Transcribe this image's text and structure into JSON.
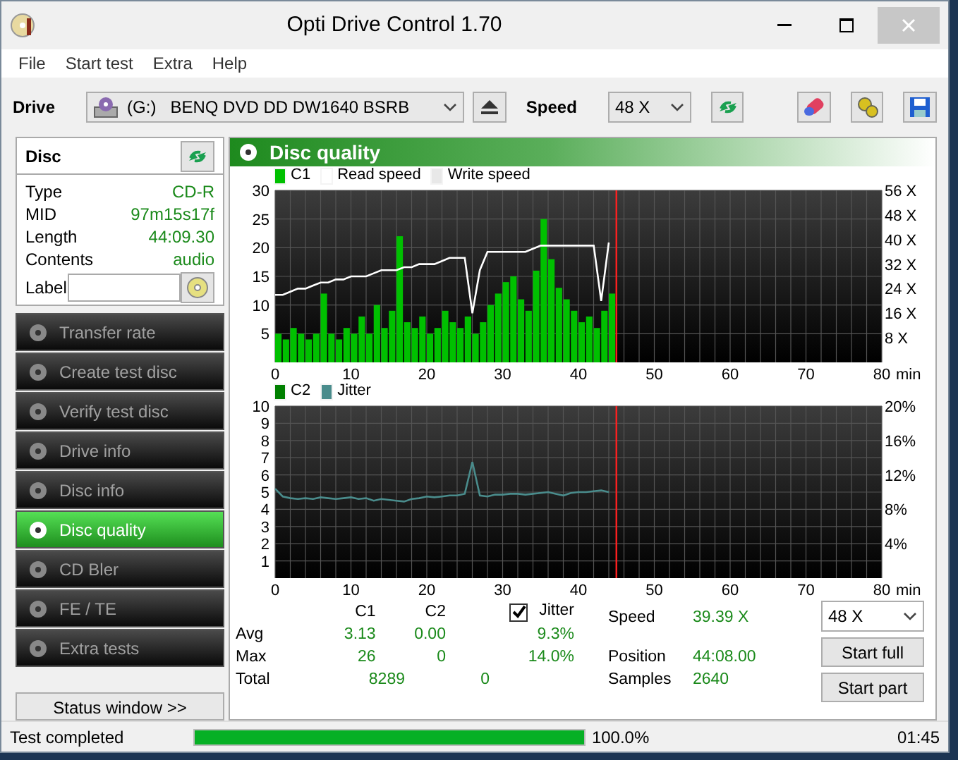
{
  "window": {
    "title": "Opti Drive Control 1.70"
  },
  "menu": [
    "File",
    "Start test",
    "Extra",
    "Help"
  ],
  "toolbar": {
    "drive_label": "Drive",
    "drive": "(G:)   BENQ DVD DD DW1640 BSRB",
    "speed_label": "Speed",
    "speed": "48 X"
  },
  "disc": {
    "title": "Disc",
    "fields": [
      {
        "label": "Type",
        "value": "CD-R"
      },
      {
        "label": "MID",
        "value": "97m15s17f"
      },
      {
        "label": "Length",
        "value": "44:09.30"
      },
      {
        "label": "Contents",
        "value": "audio"
      }
    ],
    "label_field": "Label"
  },
  "nav": [
    {
      "label": "Transfer rate",
      "selected": false
    },
    {
      "label": "Create test disc",
      "selected": false
    },
    {
      "label": "Verify test disc",
      "selected": false
    },
    {
      "label": "Drive info",
      "selected": false
    },
    {
      "label": "Disc info",
      "selected": false
    },
    {
      "label": "Disc quality",
      "selected": true
    },
    {
      "label": "CD Bler",
      "selected": false
    },
    {
      "label": "FE / TE",
      "selected": false
    },
    {
      "label": "Extra tests",
      "selected": false
    }
  ],
  "status_window_button": "Status window >>",
  "panel": {
    "title": "Disc quality",
    "charts": [
      {
        "chart_data": {
          "type": "bar",
          "xlabel": "min",
          "x": [
            0,
            1,
            2,
            3,
            4,
            5,
            6,
            7,
            8,
            9,
            10,
            11,
            12,
            13,
            14,
            15,
            16,
            17,
            18,
            19,
            20,
            21,
            22,
            23,
            24,
            25,
            26,
            27,
            28,
            29,
            30,
            31,
            32,
            33,
            34,
            35,
            36,
            37,
            38,
            39,
            40,
            41,
            42,
            43,
            44
          ],
          "xlim": [
            0,
            80
          ],
          "ylim": [
            0,
            30
          ],
          "xticks": [
            0,
            10,
            20,
            30,
            40,
            50,
            60,
            70,
            80
          ],
          "yticks": [
            5,
            10,
            15,
            20,
            25,
            30
          ],
          "grid": true,
          "ref_lines": [
            {
              "axis": "x",
              "value": 45,
              "color": "#ff2020"
            }
          ],
          "y2lim": [
            0,
            56
          ],
          "y2ticks": [
            {
              "value": 8,
              "label": "8 X"
            },
            {
              "value": 16,
              "label": "16 X"
            },
            {
              "value": 24,
              "label": "24 X"
            },
            {
              "value": 32,
              "label": "32 X"
            },
            {
              "value": 40,
              "label": "40 X"
            },
            {
              "value": 48,
              "label": "48 X"
            },
            {
              "value": 56,
              "label": "56 X"
            }
          ],
          "series": [
            {
              "name": "C1",
              "color": "#00c000",
              "values": [
                5,
                4,
                6,
                5,
                4,
                5,
                12,
                5,
                4,
                6,
                5,
                8,
                5,
                10,
                6,
                9,
                22,
                7,
                6,
                8,
                5,
                6,
                9,
                7,
                6,
                8,
                5,
                7,
                10,
                12,
                14,
                15,
                11,
                9,
                16,
                25,
                18,
                13,
                11,
                9,
                7,
                8,
                6,
                9,
                12
              ]
            },
            {
              "name": "Read speed",
              "color": "#ffffff",
              "type": "line",
              "axis": "y2",
              "values": [
                22,
                22,
                23,
                24,
                24,
                25,
                26,
                26,
                27,
                27,
                28,
                28,
                28,
                29,
                30,
                30,
                30,
                31,
                31,
                32,
                32,
                32,
                33,
                34,
                34,
                34,
                16,
                30,
                36,
                36,
                36,
                36,
                36,
                36,
                37,
                38,
                38,
                38,
                38,
                38,
                38,
                38,
                38,
                20,
                39
              ]
            }
          ]
        },
        "extra_legend": [
          {
            "label": "Write speed",
            "color": "#e8e8e8"
          }
        ]
      },
      {
        "chart_data": {
          "type": "bar",
          "xlabel": "min",
          "x": [
            0,
            1,
            2,
            3,
            4,
            5,
            6,
            7,
            8,
            9,
            10,
            11,
            12,
            13,
            14,
            15,
            16,
            17,
            18,
            19,
            20,
            21,
            22,
            23,
            24,
            25,
            26,
            27,
            28,
            29,
            30,
            31,
            32,
            33,
            34,
            35,
            36,
            37,
            38,
            39,
            40,
            41,
            42,
            43,
            44
          ],
          "xlim": [
            0,
            80
          ],
          "ylim": [
            0,
            10
          ],
          "xticks": [
            0,
            10,
            20,
            30,
            40,
            50,
            60,
            70,
            80
          ],
          "yticks": [
            1,
            2,
            3,
            4,
            5,
            6,
            7,
            8,
            9,
            10
          ],
          "grid": true,
          "ref_lines": [
            {
              "axis": "x",
              "value": 45,
              "color": "#ff2020"
            }
          ],
          "y2lim": [
            0,
            20
          ],
          "y2ticks": [
            {
              "value": 4,
              "label": "4%"
            },
            {
              "value": 8,
              "label": "8%"
            },
            {
              "value": 12,
              "label": "12%"
            },
            {
              "value": 16,
              "label": "16%"
            },
            {
              "value": 20,
              "label": "20%"
            }
          ],
          "series": [
            {
              "name": "C2",
              "color": "#008000",
              "values": [
                0,
                0,
                0,
                0,
                0,
                0,
                0,
                0,
                0,
                0,
                0,
                0,
                0,
                0,
                0,
                0,
                0,
                0,
                0,
                0,
                0,
                0,
                0,
                0,
                0,
                0,
                0,
                0,
                0,
                0,
                0,
                0,
                0,
                0,
                0,
                0,
                0,
                0,
                0,
                0,
                0,
                0,
                0,
                0,
                0
              ]
            },
            {
              "name": "Jitter",
              "color": "#4a8c8c",
              "type": "line",
              "axis": "y2",
              "values": [
                10.4,
                9.5,
                9.3,
                9.2,
                9.3,
                9.2,
                9.4,
                9.3,
                9.2,
                9.3,
                9.4,
                9.2,
                9.3,
                9.0,
                9.2,
                9.1,
                9.0,
                8.9,
                9.2,
                9.3,
                9.5,
                9.4,
                9.5,
                9.6,
                9.6,
                9.8,
                13.5,
                9.6,
                9.5,
                9.7,
                9.7,
                9.8,
                9.8,
                9.7,
                9.8,
                9.9,
                10.0,
                9.8,
                9.6,
                9.9,
                10.0,
                10.0,
                10.1,
                10.2,
                10.0
              ]
            }
          ]
        }
      }
    ],
    "stats": {
      "columns": [
        "C1",
        "C2"
      ],
      "jitter": {
        "label": "Jitter",
        "checked": true
      },
      "rows": [
        {
          "label": "Avg",
          "c1": "3.13",
          "c2": "0.00",
          "jitter": "9.3%"
        },
        {
          "label": "Max",
          "c1": "26",
          "c2": "0",
          "jitter": "14.0%"
        },
        {
          "label": "Total",
          "c1": "8289",
          "c2": "0"
        }
      ],
      "info": [
        {
          "label": "Speed",
          "value": "39.39 X"
        },
        {
          "label": "Position",
          "value": "44:08.00"
        },
        {
          "label": "Samples",
          "value": "2640"
        }
      ],
      "speed": "48 X",
      "buttons": [
        "Start full",
        "Start part"
      ]
    }
  },
  "status_bar": {
    "text": "Test completed",
    "progress": {
      "level": 1.0
    },
    "percent": "100.0%",
    "time": "01:45"
  }
}
